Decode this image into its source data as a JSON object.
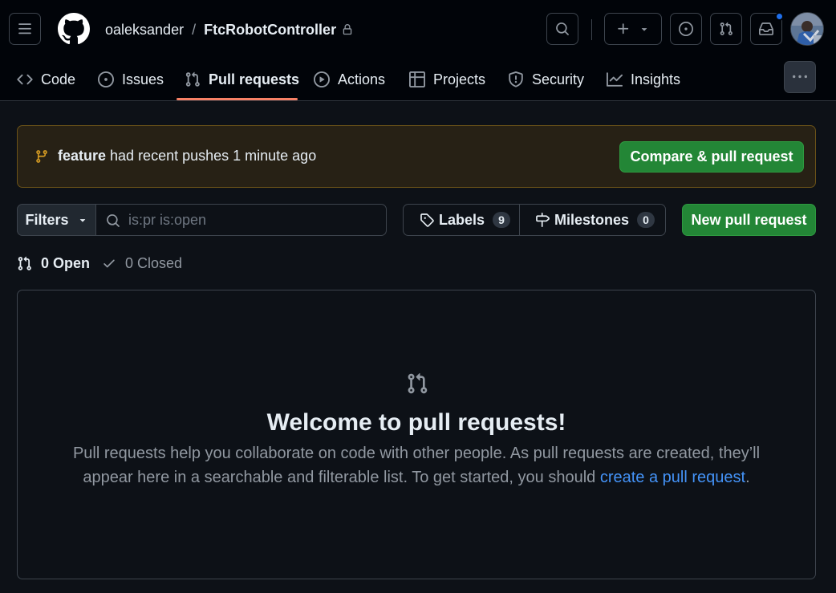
{
  "header": {
    "owner": "oaleksander",
    "separator": "/",
    "repo": "FtcRobotController"
  },
  "repo_nav": {
    "items": [
      {
        "label": "Code",
        "icon": "code-icon"
      },
      {
        "label": "Issues",
        "icon": "issue-opened-icon"
      },
      {
        "label": "Pull requests",
        "icon": "git-pull-request-icon",
        "active": true
      },
      {
        "label": "Actions",
        "icon": "play-icon"
      },
      {
        "label": "Projects",
        "icon": "table-icon"
      },
      {
        "label": "Security",
        "icon": "shield-icon"
      },
      {
        "label": "Insights",
        "icon": "graph-icon"
      }
    ]
  },
  "banner": {
    "branch": "feature",
    "message": "had recent pushes 1 minute ago",
    "button": "Compare & pull request"
  },
  "filters": {
    "button": "Filters",
    "search_placeholder": "is:pr is:open",
    "labels": "Labels",
    "labels_count": "9",
    "milestones": "Milestones",
    "milestones_count": "0",
    "new_pr": "New pull request"
  },
  "states": {
    "open": "0 Open",
    "closed": "0 Closed"
  },
  "blankslate": {
    "title": "Welcome to pull requests!",
    "text": "Pull requests help you collaborate on code with other people. As pull requests are created, they’ll appear here in a searchable and filterable list. To get started, you should",
    "link": "create a pull request",
    "end": "."
  },
  "colors": {
    "background": "#0d1117",
    "header_bg": "#010409",
    "primary_button": "#238636",
    "link": "#4493f8",
    "tab_underline": "#f78166",
    "banner_bg": "#272115",
    "banner_border": "#6b5318",
    "notification_dot": "#1f6feb"
  }
}
